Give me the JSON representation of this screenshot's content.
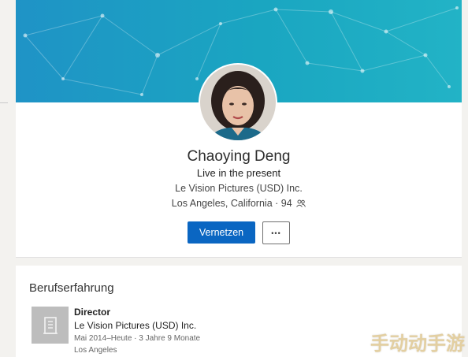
{
  "profile": {
    "name": "Chaoying Deng",
    "headline": "Live in the present",
    "company": "Le Vision Pictures (USD) Inc.",
    "location": "Los Angeles, California",
    "separator": "·",
    "connections": "94",
    "connect_label": "Vernetzen",
    "more_label": "•••"
  },
  "experience": {
    "section_title": "Berufserfahrung",
    "items": [
      {
        "title": "Director",
        "company": "Le Vision Pictures (USD) Inc.",
        "dates": "Mai 2014–Heute  ·  3 Jahre 9 Monate",
        "location": "Los Angeles"
      }
    ]
  },
  "watermark": "手动动手游",
  "colors": {
    "banner": "#1aa6c1",
    "primary_button": "#0a66c2"
  },
  "icons": [
    "connections-icon",
    "building-icon",
    "more-icon"
  ]
}
